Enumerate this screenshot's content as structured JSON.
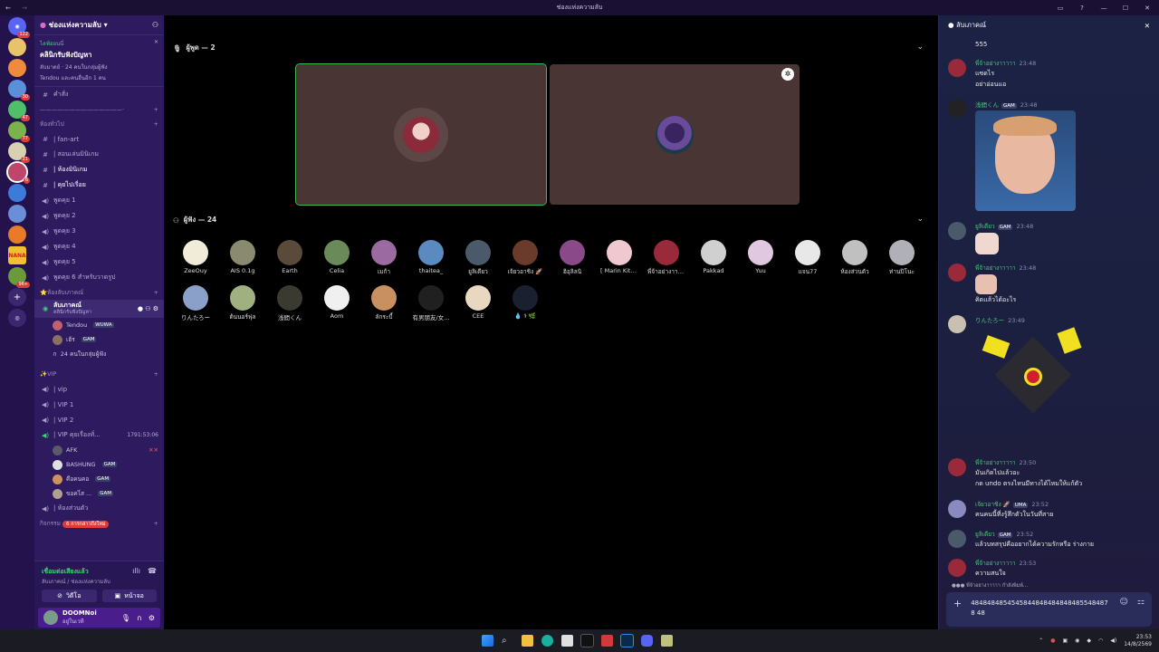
{
  "window": {
    "title": "ช่องแห่งความลับ",
    "back_glyph": "←",
    "forward_glyph": "→"
  },
  "guilds": {
    "badges": [
      "122",
      "",
      "",
      "30",
      "47",
      "77",
      "21",
      "6",
      "",
      "",
      "",
      "",
      "",
      "96+"
    ]
  },
  "server": {
    "name": "ช่องแห่งความลับ",
    "event": {
      "label": "ไลฟ์ออนนี่",
      "title": "คลินิกรับฟังปัญหา",
      "meta": "ลับมาตย์ · 24 คนในกลุ่มผู้ฟัง",
      "sub": "Tendou และคนอื่นอีก 1 คน"
    },
    "commands": "คำสั่ง",
    "divider": "——————————————·",
    "cat1": "ห้องทั่วไป",
    "text_channels": [
      "| fan-art",
      "| สอนเล่นมินิเกม",
      "| ห้องมินิเกม",
      "| คุยไปเรื่อย"
    ],
    "voice_channels": [
      "พูดคุย 1",
      "พูดคุย 2",
      "พูดคุย 3",
      "พูดคุย 4",
      "พูดคุย 5",
      "พูดคุย 6 สำหรับวาดรูป"
    ],
    "cat2": "⭐ห้องลับเภาคณ์",
    "stage_channel": {
      "name": "ลับเภาคณ์",
      "topic": "คลินิกรับฟังปัญหา"
    },
    "stage_users": [
      {
        "name": "Tendou",
        "tag": "WUWA"
      },
      {
        "name": "เฮ้ร",
        "tag": "GAM"
      }
    ],
    "stage_listeners": "24 คนในกลุ่มผู้ฟัง",
    "cat3": "✨VIP",
    "vip_channels": [
      "| vip",
      "| VIP 1",
      "| VIP 2",
      "| VIP คุยเรื่องทั่..."
    ],
    "vip_timer": "1791:53:06",
    "afk_label": "AFK",
    "vip_users": [
      {
        "name": "BASHUNG",
        "tag": "GAM"
      },
      {
        "name": "คือคนคอ",
        "tag": "GAM"
      },
      {
        "name": "ขอคไ่ส ...",
        "tag": "GAM"
      }
    ],
    "private_room": "| ห้องส่วนตัว",
    "cat4": "กิจกรรม",
    "new_mentions": "6 การกล่าวถึงใหม่"
  },
  "voice": {
    "status": "เชื่อมต่อเสียงแล้ว",
    "location": "ลับเภาคณ์ / ช่องแห่งความลับ",
    "video": "วิดีโอ",
    "screen": "หน้าจอ"
  },
  "user": {
    "name": "DOOMNoi",
    "status": "อยู่ในเวที"
  },
  "stage": {
    "speakers_header": "ผู้พูด — 2",
    "audience_header": "ผู้ฟัง — 24",
    "audience": [
      "ZeeOuy",
      "AIS 0.1g",
      "Earth",
      "Celia",
      "เมก้า",
      "thaitea_",
      "ยูลิเดียว",
      "เจ้ยวอาชิง 🚀",
      "ฮิอุลิลนิ",
      "[ Marin Kitaka...",
      "พี่จ้าอย่างาาา...",
      "Pakkad",
      "Yuu",
      "แจน77",
      "ห้องส่วนตัว",
      "ท่านปิโนะ",
      "りんたろー",
      "ต้นนอร์ฟุล",
      "浅間くん",
      "Aom",
      "ลักระบี้",
      "有男朋友/女...",
      "CEE",
      "💧 ⚕ 🌿"
    ]
  },
  "chat": {
    "title": "ลับเภาคณ์",
    "messages": [
      {
        "text": "555"
      },
      {
        "author": "พี่จ้าอย่างาาาาา",
        "time": "23:48",
        "lines": [
          "แซดไร",
          "อย่าอ่อนแอ"
        ]
      },
      {
        "author": "浅間くん",
        "tag": "GAM",
        "time": "23:48"
      },
      {
        "author": "ยูลิเดียว",
        "tag": "GAM",
        "time": "23:48"
      },
      {
        "author": "พี่จ้าอย่างาาาาา",
        "time": "23:48",
        "lines": [
          "คิดแล้วได้อะไร"
        ]
      },
      {
        "author": "りんたろー",
        "time": "23:49"
      },
      {
        "author": "พี่จ้าอย่างาาาาา",
        "time": "23:50",
        "lines": [
          "มันเกิดไปแล้วอะ",
          "กด undo ตรงไหนมีทางได้ไหมให้แก้ตัว"
        ]
      },
      {
        "author": "เจ้ยวอาชิง 🚀",
        "tag": "UMA",
        "time": "23:52",
        "lines": [
          "คนคนนี้ที่งรู้สึกตัวในวันที่สาย"
        ]
      },
      {
        "author": "ยูลิเดียว",
        "tag": "GAM",
        "time": "23:52",
        "lines": [
          "แล้วบทสรุปคืออยากได้ความรักหรือ ร่างกาย"
        ]
      },
      {
        "author": "พี่จ้าอย่างาาาาา",
        "time": "23:53",
        "lines": [
          "ความสนใจ"
        ]
      }
    ],
    "typing": "พี่จ้าอย่างาาาาา กำลังพิมพ์...",
    "input_value": "48484848545458448484848484855484878 48"
  },
  "taskbar": {
    "time": "23:53",
    "date": "14/8/2569"
  },
  "colors": {
    "accent_green": "#3fb950",
    "sidebar": "#2e1a5e",
    "guild_bar": "#24124d",
    "stage_tile": "#4a3535"
  }
}
